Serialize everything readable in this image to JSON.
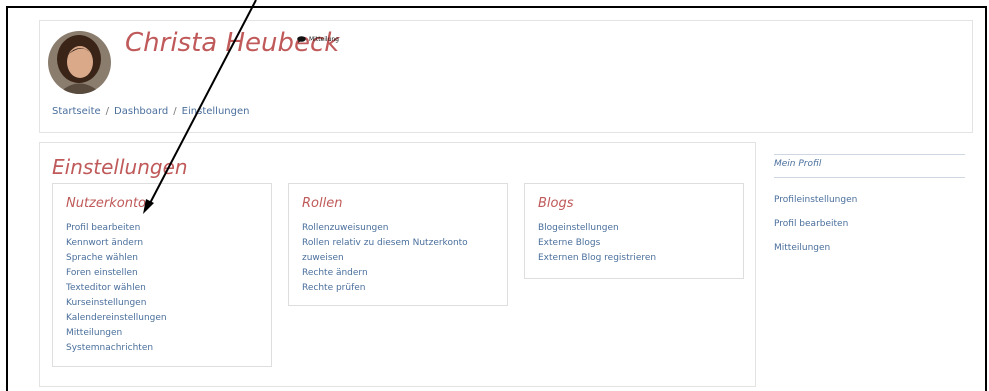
{
  "header": {
    "user_name": "Christa Heubeck",
    "message_label": "Mitteilung",
    "breadcrumb": [
      "Startseite",
      "Dashboard",
      "Einstellungen"
    ]
  },
  "main": {
    "title": "Einstellungen",
    "panels": [
      {
        "title": "Nutzerkonto",
        "items": [
          "Profil bearbeiten",
          "Kennwort ändern",
          "Sprache wählen",
          "Foren einstellen",
          "Texteditor wählen",
          "Kurseinstellungen",
          "Kalendereinstellungen",
          "Mitteilungen",
          "Systemnachrichten"
        ]
      },
      {
        "title": "Rollen",
        "items": [
          "Rollenzuweisungen",
          "Rollen relativ zu diesem Nutzerkonto",
          "zuweisen",
          "Rechte ändern",
          "Rechte prüfen"
        ]
      },
      {
        "title": "Blogs",
        "items": [
          "Blogeinstellungen",
          "Externe Blogs",
          "Externen Blog registrieren"
        ]
      }
    ]
  },
  "sidebar": {
    "title": "Mein Profil",
    "items": [
      "Profileinstellungen",
      "Profil bearbeiten",
      "Mitteilungen"
    ]
  },
  "colors": {
    "accent_red": "#c05a5a",
    "link_blue": "#4a6f9c",
    "annotation": "#000000"
  },
  "icons": {
    "message": "speech-bubble-icon",
    "avatar": "user-photo"
  }
}
